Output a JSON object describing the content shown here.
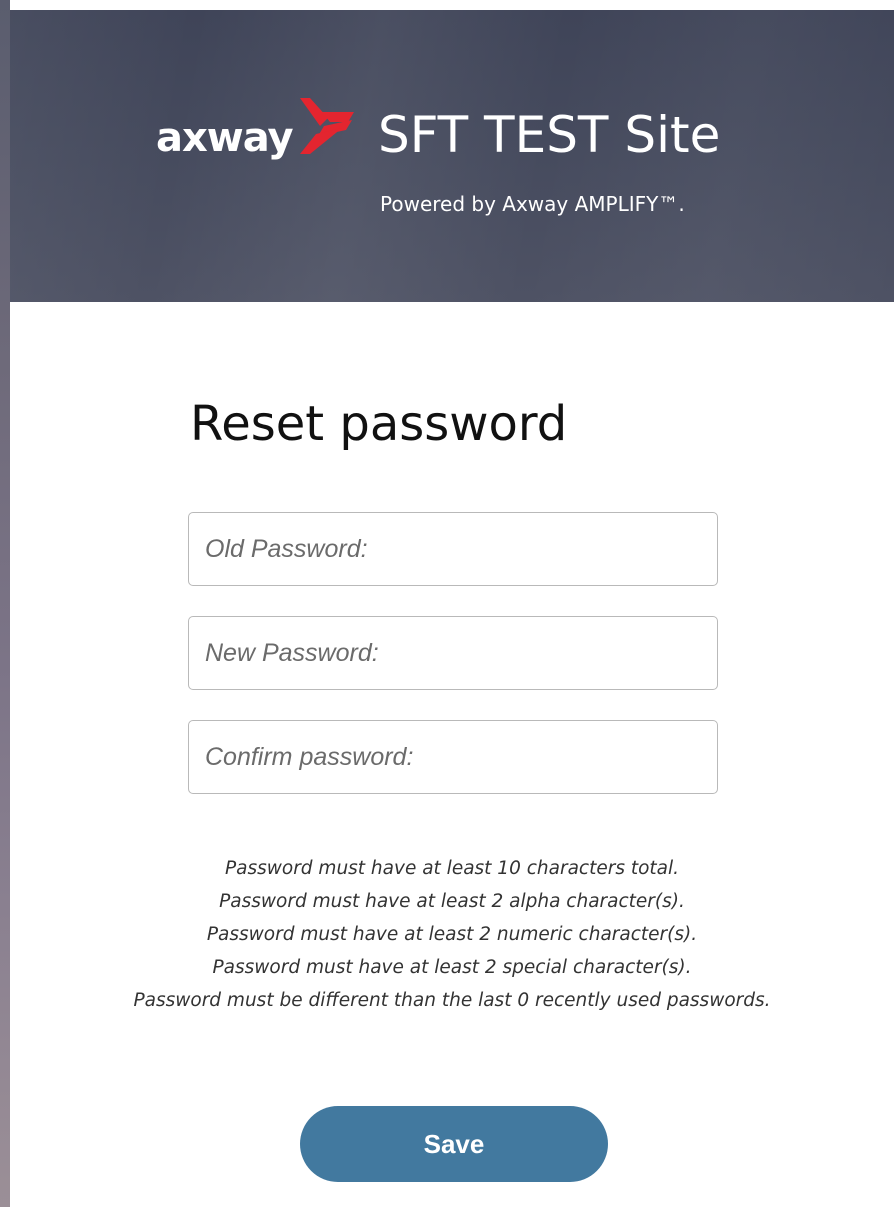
{
  "header": {
    "brand": "axway",
    "site_title": "SFT TEST Site",
    "powered_by": "Powered by Axway AMPLIFY™."
  },
  "form": {
    "heading": "Reset password",
    "fields": [
      {
        "placeholder": "Old Password:"
      },
      {
        "placeholder": "New Password:"
      },
      {
        "placeholder": "Confirm password:"
      }
    ],
    "rules": [
      "Password must have at least 10 characters total.",
      "Password must have at least 2 alpha character(s).",
      "Password must have at least 2 numeric character(s).",
      "Password must have at least 2 special character(s).",
      "Password must be different than the last 0 recently used passwords."
    ],
    "save_label": "Save"
  },
  "colors": {
    "header_bg": "#464b5e",
    "brand_mark_red": "#e4252f",
    "button_bg": "#42799f",
    "text_dark": "#111111"
  },
  "icons": {
    "brand_mark": "axway-chevron-logo-icon"
  }
}
